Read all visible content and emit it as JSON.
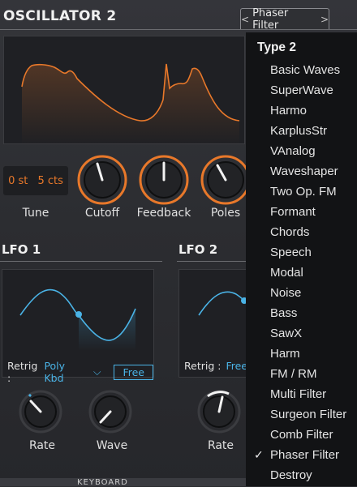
{
  "oscillator": {
    "title": "OSCILLATOR 2",
    "filter_tab": {
      "prev_icon": "<",
      "label": "Phaser Filter",
      "next_icon": ">"
    },
    "tune": {
      "semitones": "0 st",
      "cents": "5 cts",
      "label": "Tune"
    },
    "knobs": [
      {
        "label": "Cutoff"
      },
      {
        "label": "Feedback"
      },
      {
        "label": "Poles"
      }
    ]
  },
  "lfo1": {
    "title": "LFO 1",
    "retrig_label": "Retrig :",
    "retrig_value": "Poly Kbd",
    "free_label": "Free",
    "knobs": [
      {
        "label": "Rate"
      },
      {
        "label": "Wave"
      }
    ]
  },
  "lfo2": {
    "title": "LFO 2",
    "retrig_label": "Retrig :",
    "retrig_value": "Free",
    "knobs": [
      {
        "label": "Rate"
      }
    ]
  },
  "footer": {
    "keyboard_label": "KEYBOARD"
  },
  "menu": {
    "header": "Type 2",
    "selected": "Phaser Filter",
    "items": [
      "Basic Waves",
      "SuperWave",
      "Harmo",
      "KarplusStr",
      "VAnalog",
      "Waveshaper",
      "Two Op. FM",
      "Formant",
      "Chords",
      "Speech",
      "Modal",
      "Noise",
      "Bass",
      "SawX",
      "Harm",
      "FM / RM",
      "Multi Filter",
      "Surgeon Filter",
      "Comb Filter",
      "Phaser Filter",
      "Destroy"
    ]
  },
  "colors": {
    "accent_orange": "#e8782a",
    "accent_blue": "#4ab3e6",
    "menu_bg": "#121315"
  }
}
